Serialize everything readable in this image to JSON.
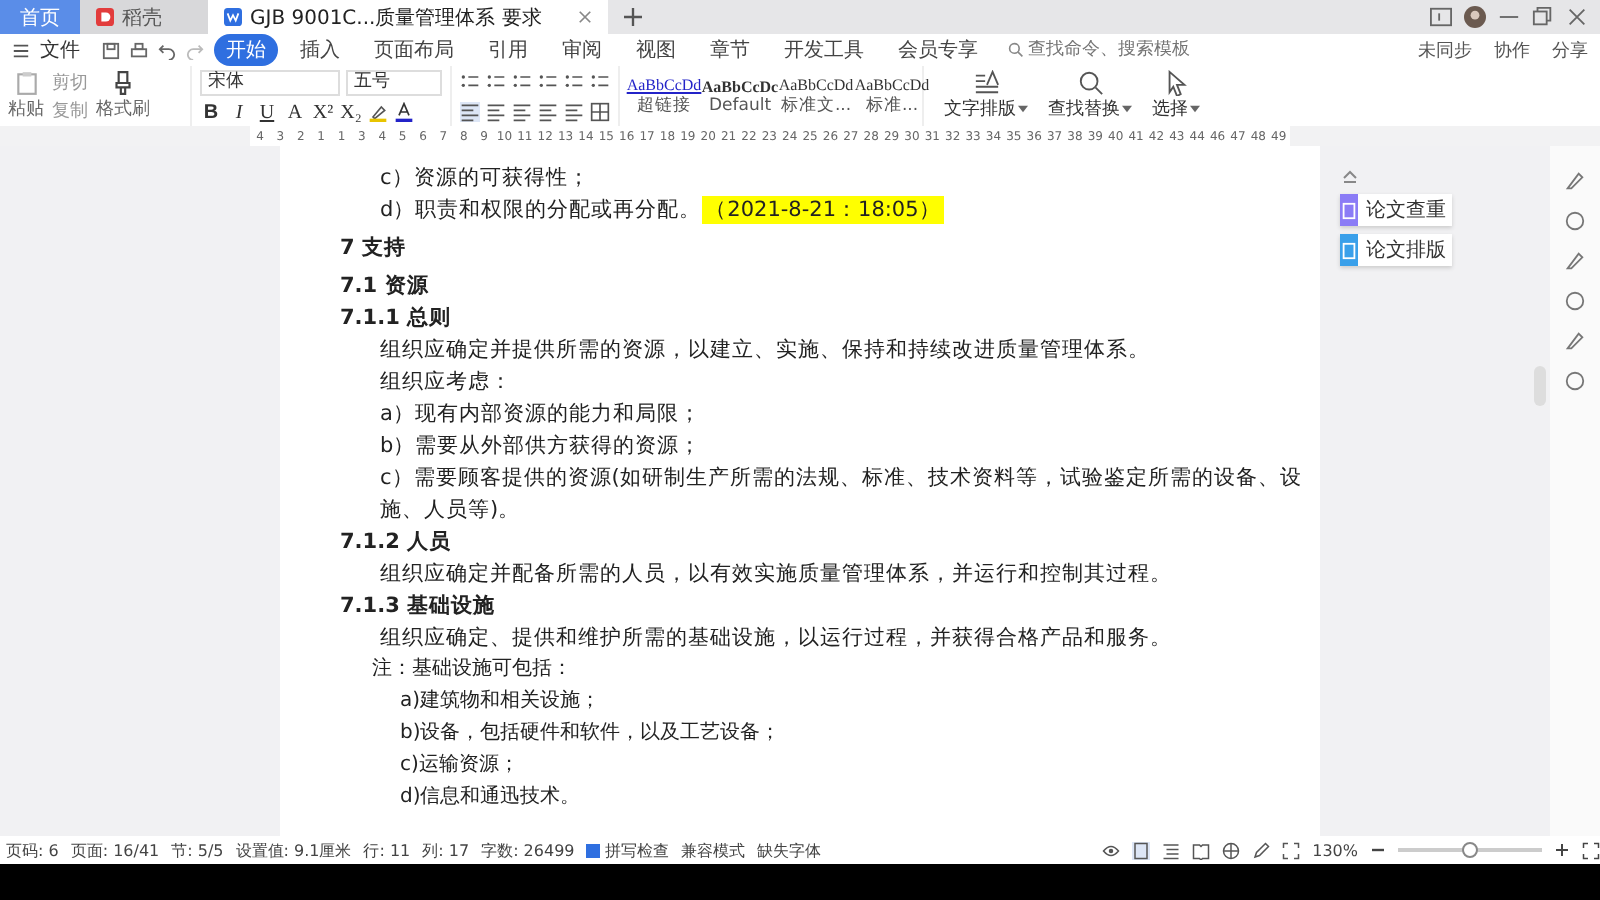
{
  "tabs": [
    {
      "kind": "home",
      "label": "首页",
      "selected": false
    },
    {
      "kind": "app",
      "label": "稻壳",
      "selected": false
    },
    {
      "kind": "doc",
      "label": "GJB 9001C...质量管理体系 要求",
      "selected": true
    }
  ],
  "menu": {
    "file": "文件",
    "items": [
      {
        "label": "开始",
        "selected": true
      },
      {
        "label": "插入",
        "selected": false
      },
      {
        "label": "页面布局",
        "selected": false
      },
      {
        "label": "引用",
        "selected": false
      },
      {
        "label": "审阅",
        "selected": false
      },
      {
        "label": "视图",
        "selected": false
      },
      {
        "label": "章节",
        "selected": false
      },
      {
        "label": "开发工具",
        "selected": false
      },
      {
        "label": "会员专享",
        "selected": false
      }
    ],
    "search": {
      "placeholder": "查找命令、搜索模板"
    },
    "actions": [
      "未同步",
      "协作",
      "分享"
    ]
  },
  "ribbon": {
    "clipboard": {
      "paste": "粘贴",
      "cut": "剪切",
      "copy": "复制",
      "painter": "格式刷"
    },
    "font": "宋体",
    "size": "五号",
    "format": [
      "B",
      "I",
      "U",
      "A",
      "X²",
      "X₂"
    ],
    "styles": [
      {
        "kind": "link",
        "sample": "AaBbCcDd",
        "label": "超链接"
      },
      {
        "kind": "bold",
        "sample": "AaBbCcDc",
        "label": "Default"
      },
      {
        "kind": "plain",
        "sample": "AaBbCcDd",
        "label": "标准文..."
      },
      {
        "kind": "plain",
        "sample": "AaBbCcDd",
        "label": "标准..."
      }
    ],
    "tools": [
      "文字排版",
      "查找替换",
      "选择"
    ]
  },
  "ruler": {
    "marks": [
      "4",
      "3",
      "2",
      "1",
      "1",
      "3",
      "4",
      "5",
      "6",
      "7",
      "8",
      "9",
      "10",
      "11",
      "12",
      "13",
      "14",
      "15",
      "16",
      "17",
      "18",
      "19",
      "20",
      "21",
      "22",
      "23",
      "24",
      "25",
      "26",
      "27",
      "28",
      "29",
      "30",
      "31",
      "32",
      "33",
      "34",
      "35",
      "36",
      "37",
      "38",
      "39",
      "40",
      "41",
      "42",
      "43",
      "44",
      "46",
      "47",
      "48",
      "49"
    ]
  },
  "document": {
    "lines": [
      {
        "kind": "item",
        "text": "c）资源的可获得性；"
      },
      {
        "kind": "item",
        "text": "d）职责和权限的分配或再分配。",
        "highlight": "（2021-8-21：18:05）"
      },
      {
        "kind": "h1",
        "text": "7 支持"
      },
      {
        "kind": "h2",
        "text": "7.1 资源"
      },
      {
        "kind": "h3",
        "text": "7.1.1 总则"
      },
      {
        "kind": "para",
        "text": "组织应确定并提供所需的资源，以建立、实施、保持和持续改进质量管理体系。"
      },
      {
        "kind": "para",
        "text": "组织应考虑："
      },
      {
        "kind": "item",
        "text": "a）现有内部资源的能力和局限；"
      },
      {
        "kind": "item",
        "text": "b）需要从外部供方获得的资源；"
      },
      {
        "kind": "item",
        "text": "c）需要顾客提供的资源(如研制生产所需的法规、标准、技术资料等，试验鉴定所需的设备、设施、人员等)。"
      },
      {
        "kind": "h3",
        "text": "7.1.2 人员"
      },
      {
        "kind": "para",
        "text": "组织应确定并配备所需的人员，以有效实施质量管理体系，并运行和控制其过程。"
      },
      {
        "kind": "h3",
        "text": "7.1.3 基础设施"
      },
      {
        "kind": "para",
        "text": "组织应确定、提供和维护所需的基础设施，以运行过程，并获得合格产品和服务。"
      },
      {
        "kind": "note",
        "text": "注：基础设施可包括："
      },
      {
        "kind": "subnote",
        "text": "a)建筑物和相关设施；"
      },
      {
        "kind": "subnote",
        "text": "b)设备，包括硬件和软件，以及工艺设备；"
      },
      {
        "kind": "subnote",
        "text": "c)运输资源；"
      },
      {
        "kind": "subnote",
        "text": "d)信息和通迅技术。"
      }
    ]
  },
  "side_panel": {
    "items": [
      {
        "kind": "check",
        "label": "论文查重"
      },
      {
        "kind": "layout",
        "label": "论文排版"
      }
    ]
  },
  "status_bar": {
    "fields": [
      "页码: 6",
      "页面: 16/41",
      "节: 5/5",
      "设置值: 9.1厘米",
      "行: 11",
      "列: 17",
      "字数: 26499"
    ],
    "spell_check": {
      "label": "拼写检查",
      "checked": true
    },
    "mode": "兼容模式",
    "missing_font": "缺失字体",
    "zoom": "130%",
    "zoom_slider": {
      "level": 0.5
    }
  }
}
